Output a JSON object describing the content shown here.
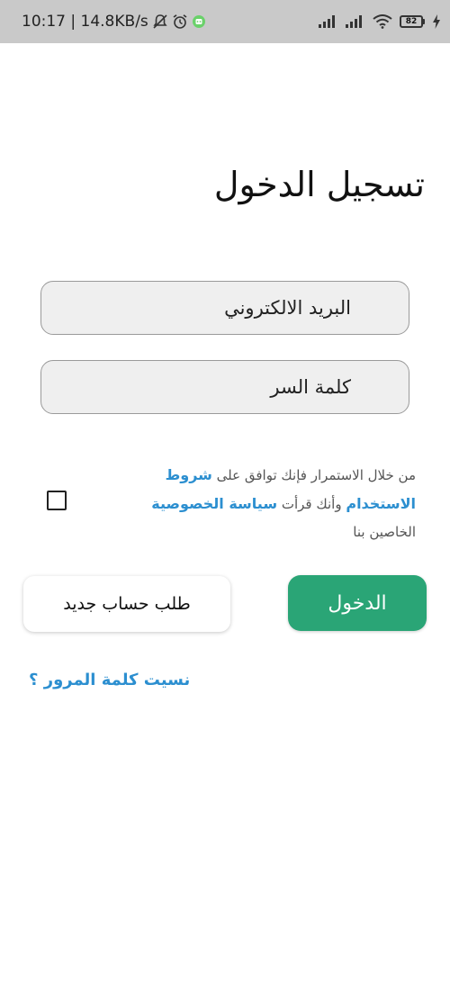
{
  "status_bar": {
    "time_speed": "10:17 | 14.8KB/s",
    "battery_level": "82",
    "battery_color": "#6ad16a",
    "icons": [
      "mute-icon",
      "alarm-icon",
      "app-notification-icon",
      "signal-icon",
      "signal-icon",
      "wifi-icon",
      "battery-icon",
      "charging-icon"
    ]
  },
  "login": {
    "title": "تسجيل الدخول",
    "email_placeholder": "البريد الالكتروني",
    "password_placeholder": "كلمة السر",
    "terms": {
      "prefix": "من خلال الاستمرار فإنك توافق على",
      "terms_link": "شروط الاستخدام",
      "middle": "وأنك قرأت",
      "privacy_link": "سياسة الخصوصية",
      "suffix": "الخاصين بنا",
      "checked": false
    },
    "login_button": "الدخول",
    "register_button": "طلب حساب جديد",
    "forgot_password": "نسيت كلمة المرور ؟",
    "colors": {
      "primary_green": "#2aa576",
      "link_blue": "#2c8fd0"
    }
  }
}
